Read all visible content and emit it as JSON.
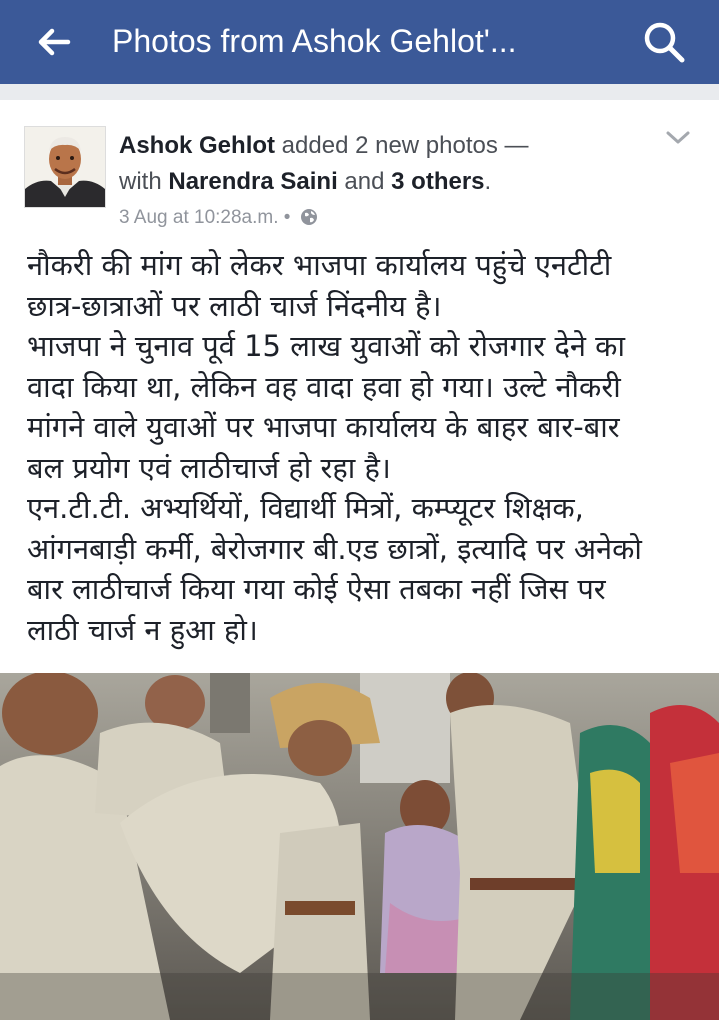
{
  "header": {
    "title": "Photos from Ashok Gehlot'...",
    "back_icon": "arrow-left-icon",
    "search_icon": "search-icon",
    "color": "#3b5998"
  },
  "post": {
    "author": "Ashok Gehlot",
    "action": " added 2 new photos —",
    "with_prefix": "with ",
    "tagged": "Narendra Saini",
    "and_text": " and ",
    "others": "3 others",
    "period": ".",
    "timestamp": "3 Aug at 10:28a.m. •",
    "privacy_icon": "globe-icon",
    "menu_icon": "chevron-down-icon",
    "lines": [
      "नौकरी की मांग को लेकर भाजपा कार्यालय पहुंचे एनटीटी",
      "छात्र-छात्राओं पर लाठी चार्ज निंदनीय है।",
      "भाजपा ने चुनाव पूर्व 15 लाख युवाओं को रोजगार देने का",
      "वादा किया था, लेकिन वह वादा हवा हो गया। उल्टे नौकरी",
      "मांगने वाले युवाओं पर भाजपा कार्यालय के बाहर बार-बार",
      "बल प्रयोग एवं लाठीचार्ज हो रहा है।",
      "एन.टी.टी. अभ्यर्थियों, विद्यार्थी मित्रों, कम्प्यूटर शिक्षक,",
      "आंगनबाड़ी कर्मी, बेरोजगार बी.एड छात्रों, इत्यादि पर अनेको",
      "बार लाठीचार्ज किया गया कोई ऐसा तबका नहीं जिस पर",
      "लाठी चार्ज न हुआ हो।"
    ]
  }
}
